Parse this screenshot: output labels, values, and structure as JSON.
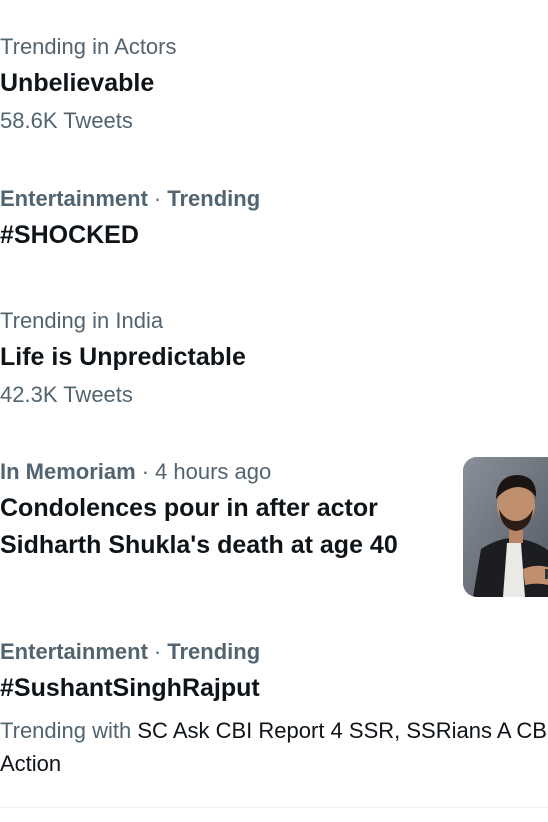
{
  "trends": [
    {
      "meta": "Trending in Actors",
      "title": "Unbelievable",
      "count": "58.6K Tweets"
    },
    {
      "category": "Entertainment",
      "status": "Trending",
      "title": "#SHOCKED"
    },
    {
      "meta": "Trending in India",
      "title": "Life is Unpredictable",
      "count": "42.3K Tweets"
    }
  ],
  "news": {
    "category": "In Memoriam",
    "time": "4 hours ago",
    "title": "Condolences pour in after actor Sidharth Shukla's death at age 40",
    "image_icon": "person-photo"
  },
  "trend_with": {
    "category": "Entertainment",
    "status": "Trending",
    "title": "#SushantSinghRajput",
    "lead": "Trending with",
    "related": "SC Ask CBI Report 4 SSR, SSRians A CBI Action"
  },
  "colors": {
    "primary_text": "#0f1419",
    "secondary_text": "#536471",
    "divider": "#eff3f4"
  }
}
